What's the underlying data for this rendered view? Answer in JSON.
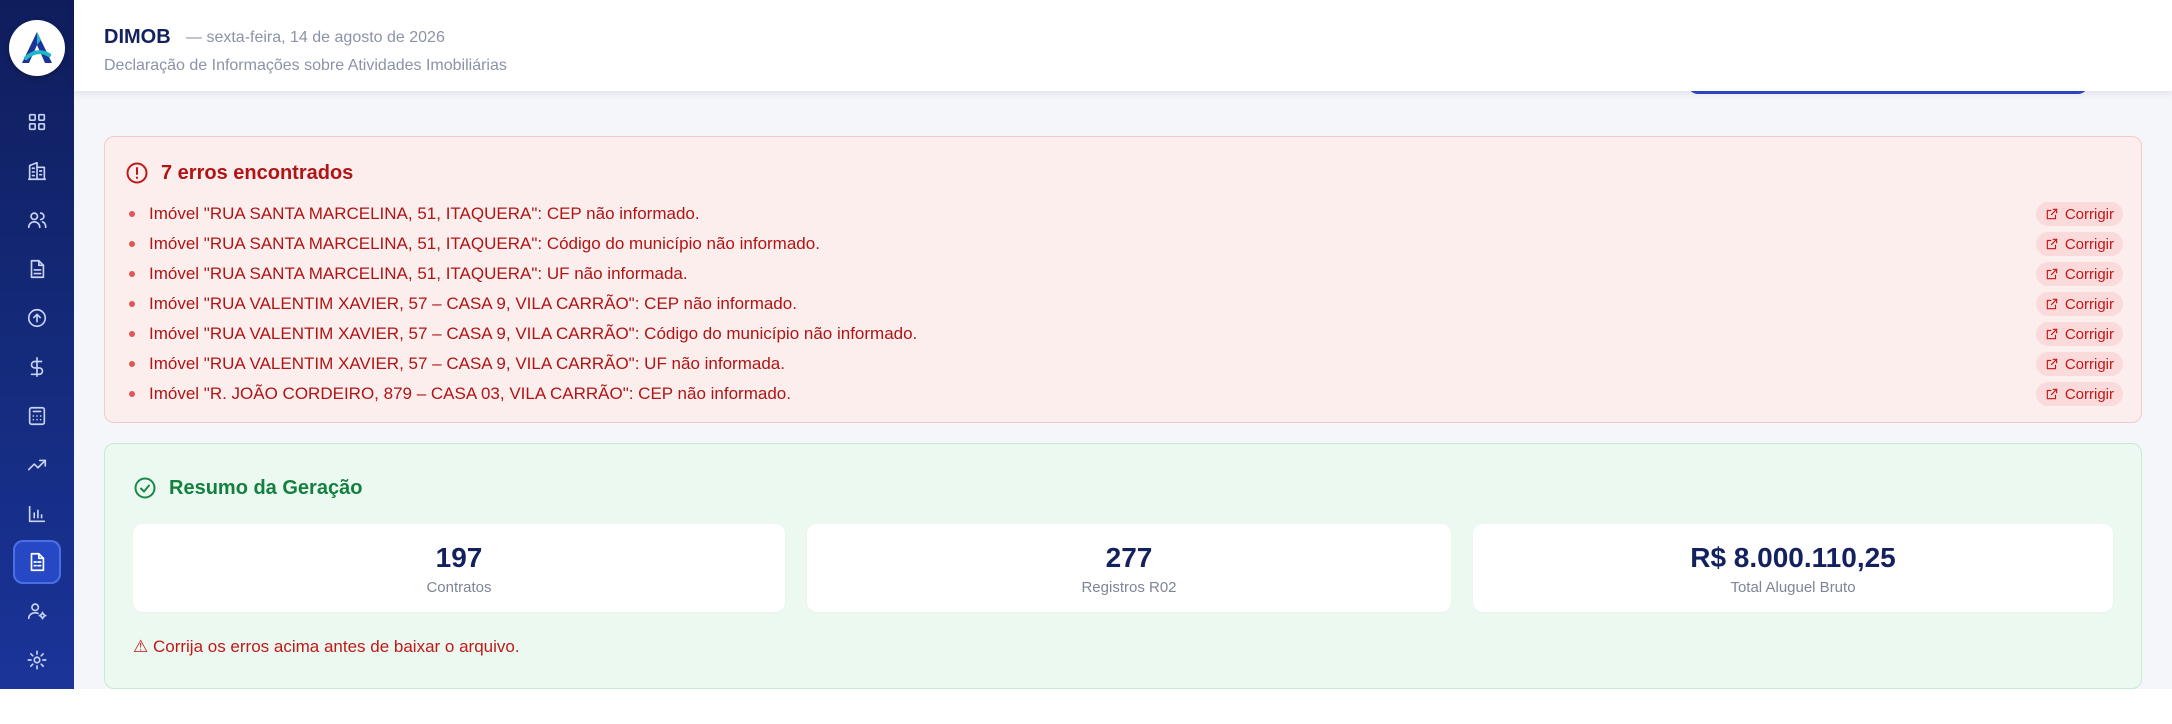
{
  "header": {
    "title": "DIMOB",
    "date": "— sexta-feira, 14 de agosto de 2026",
    "subtitle": "Declaração de Informações sobre Atividades Imobiliárias"
  },
  "sidebar": {
    "logo_letter": "A",
    "items": [
      {
        "icon": "dashboard-icon"
      },
      {
        "icon": "building-icon"
      },
      {
        "icon": "users-icon"
      },
      {
        "icon": "document-icon"
      },
      {
        "icon": "upload-icon"
      },
      {
        "icon": "dollar-icon"
      },
      {
        "icon": "calculator-icon"
      },
      {
        "icon": "trending-icon"
      },
      {
        "icon": "bar-chart-icon"
      },
      {
        "icon": "dimob-report-icon",
        "active": true
      },
      {
        "icon": "user-settings-icon"
      },
      {
        "icon": "gear-icon"
      }
    ]
  },
  "errors": {
    "title": "7 erros encontrados",
    "fix_label": "Corrigir",
    "items": [
      "Imóvel \"RUA SANTA MARCELINA, 51, ITAQUERA\": CEP não informado.",
      "Imóvel \"RUA SANTA MARCELINA, 51, ITAQUERA\": Código do município não informado.",
      "Imóvel \"RUA SANTA MARCELINA, 51, ITAQUERA\": UF não informada.",
      "Imóvel \"RUA VALENTIM XAVIER, 57 – CASA 9, VILA CARRÃO\": CEP não informado.",
      "Imóvel \"RUA VALENTIM XAVIER, 57 – CASA 9, VILA CARRÃO\": Código do município não informado.",
      "Imóvel \"RUA VALENTIM XAVIER, 57 – CASA 9, VILA CARRÃO\": UF não informada.",
      "Imóvel \"R. JOÃO CORDEIRO, 879 – CASA 03, VILA CARRÃO\": CEP não informado."
    ]
  },
  "summary": {
    "title": "Resumo da Geração",
    "stats": [
      {
        "value": "197",
        "label": "Contratos"
      },
      {
        "value": "277",
        "label": "Registros R02"
      },
      {
        "value": "R$ 8.000.110,25",
        "label": "Total Aluguel Bruto"
      }
    ],
    "warning": "⚠ Corrija os erros acima antes de baixar o arquivo."
  },
  "colors": {
    "sidebar": "#142a7a",
    "accent": "#2748c4",
    "error": "#b01414",
    "success": "#14803f"
  }
}
